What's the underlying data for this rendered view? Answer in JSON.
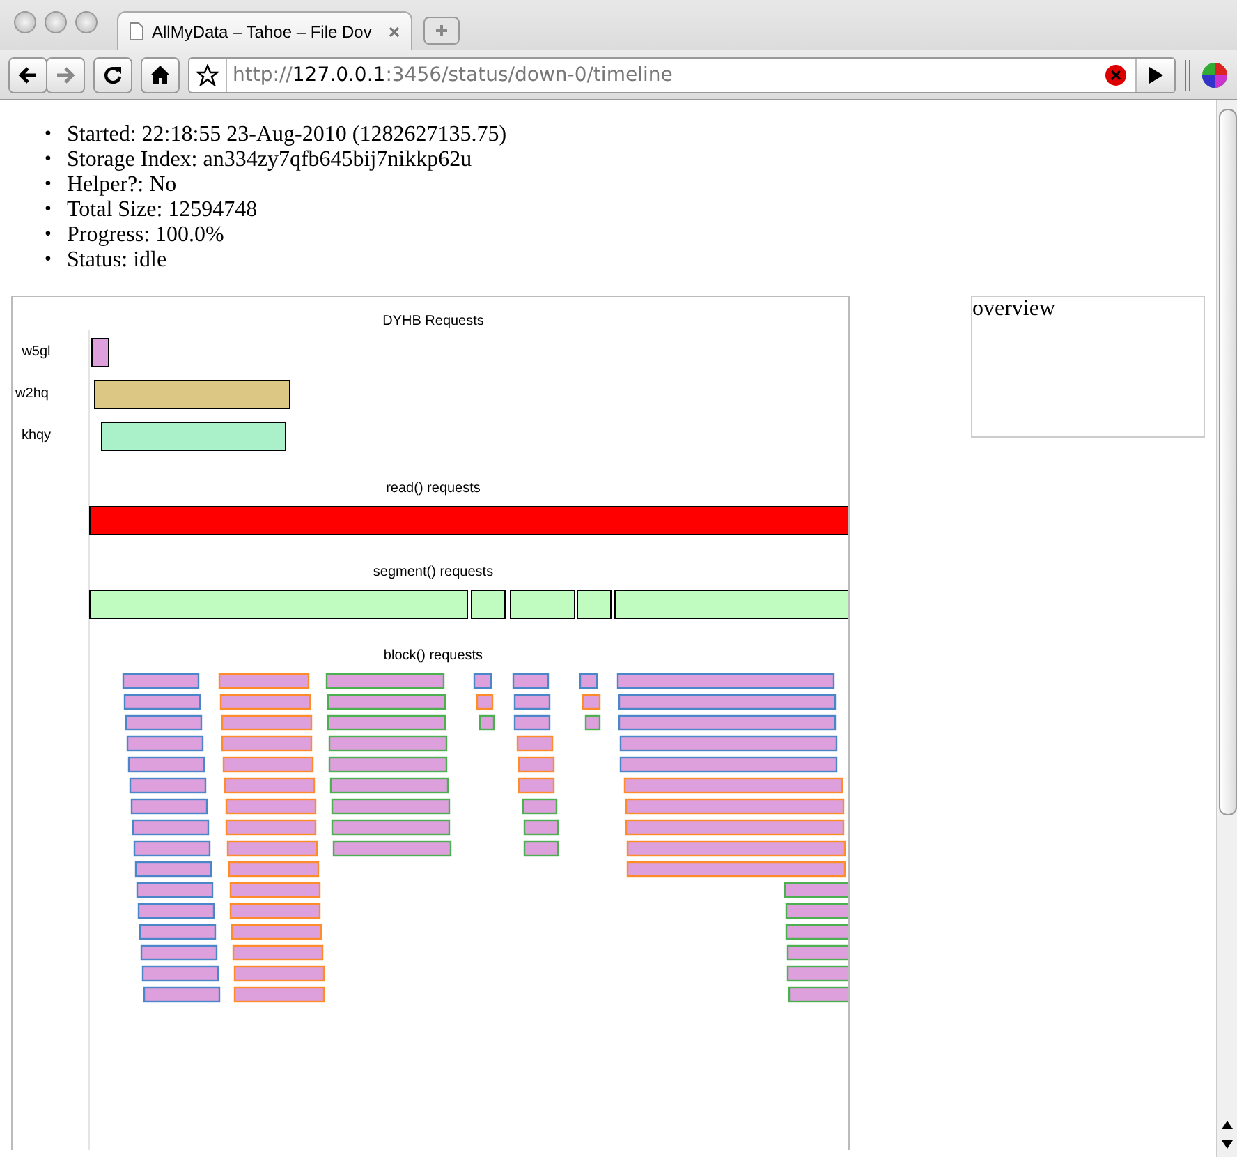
{
  "window": {
    "tab_title": "AllMyData – Tahoe – File Dov"
  },
  "address_bar": {
    "scheme": "http://",
    "host": "127.0.0.1",
    "path": ":3456/status/down-0/timeline"
  },
  "info_list": [
    {
      "bullet": "•",
      "text": "Started: 22:18:55 23-Aug-2010 (1282627135.75)"
    },
    {
      "bullet": "•",
      "text": "Storage Index: an334zy7qfb645bij7nikkp62u"
    },
    {
      "bullet": "•",
      "text": "Helper?: No"
    },
    {
      "bullet": "•",
      "text": "Total Size: 12594748"
    },
    {
      "bullet": "•",
      "text": "Progress: 100.0%"
    },
    {
      "bullet": "•",
      "text": "Status: idle"
    }
  ],
  "timeline": {
    "dyhb_title": "DYHB Requests",
    "servers": [
      {
        "label": "w5gl",
        "color": "#dda0dd"
      },
      {
        "label": "w2hq",
        "color": "#dcc785"
      },
      {
        "label": "khqy",
        "color": "#aaf0c8"
      }
    ],
    "read_title": "read() requests",
    "segment_title": "segment() requests",
    "block_title": "block() requests"
  },
  "overview": {
    "title": "overview"
  }
}
